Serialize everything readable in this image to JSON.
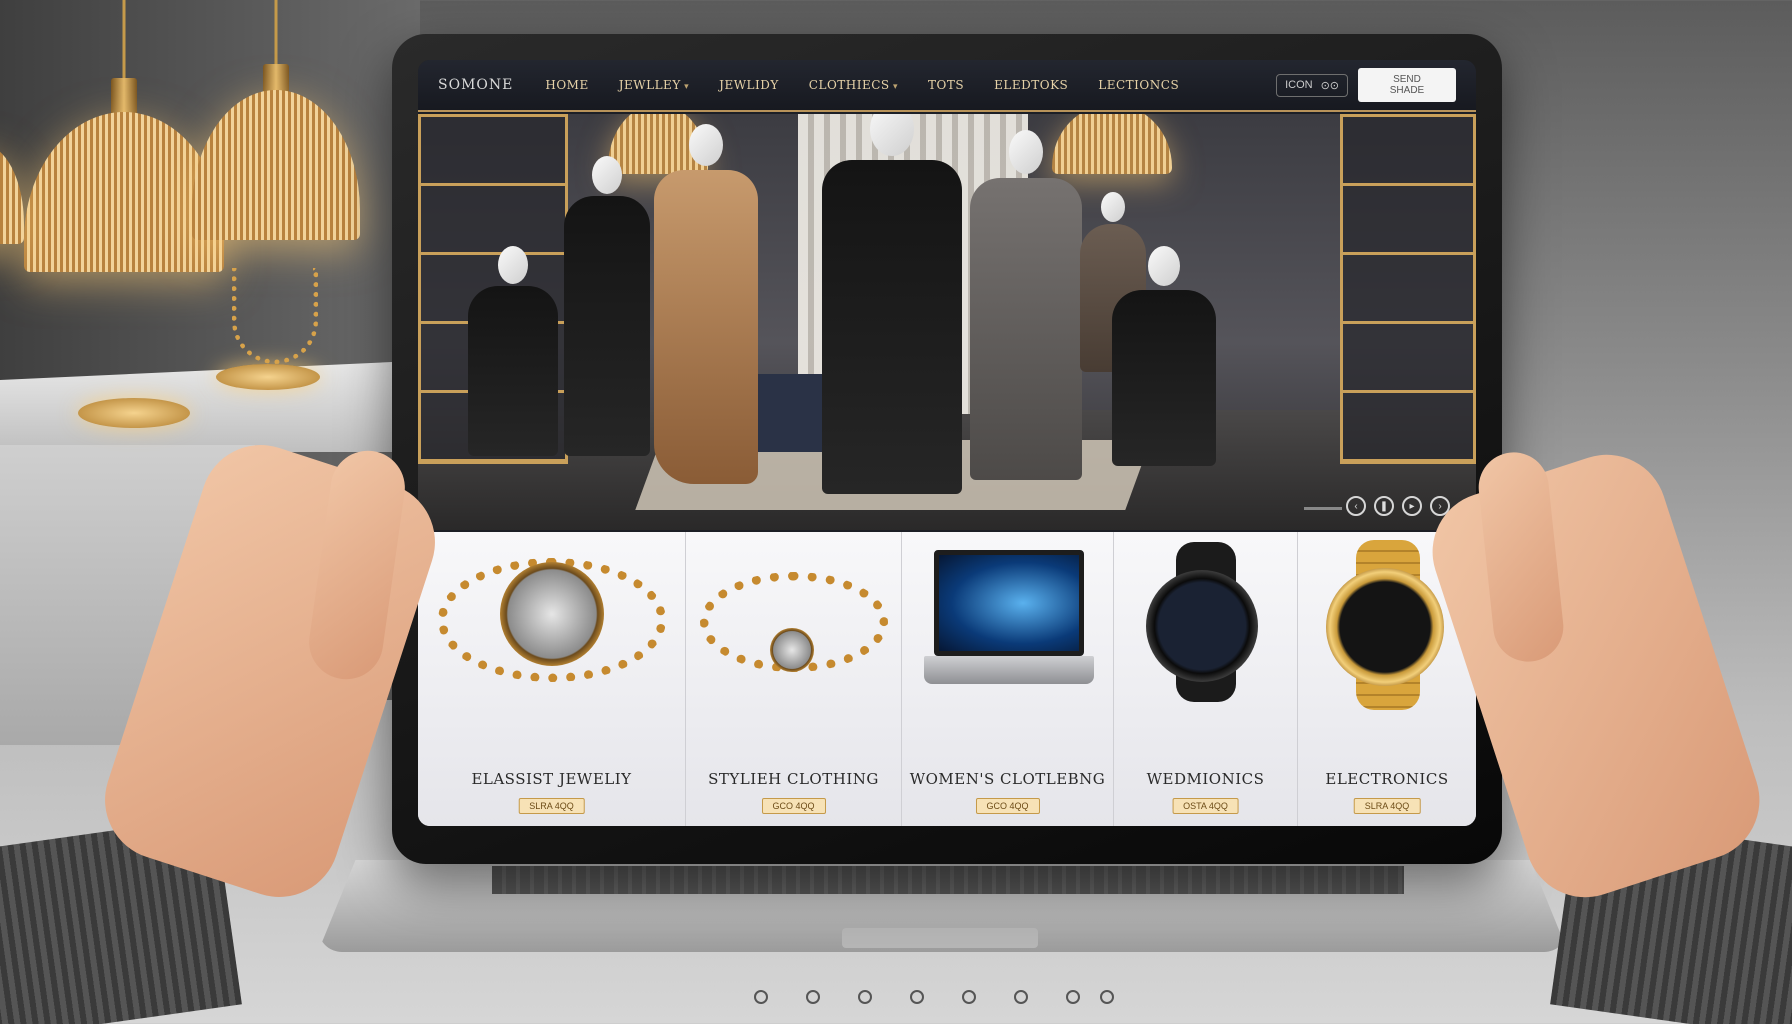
{
  "nav": {
    "brand": "SOMONE",
    "links": [
      "HOME",
      "JEWLLEY",
      "JEWLIDY",
      "CLOTHIECS",
      "TOTS",
      "ELEDTOKS",
      "LECTIONCS"
    ],
    "pill_text": "ICON",
    "search_placeholder": "SEND SHADE"
  },
  "products": [
    {
      "title": "ELASSIST JEWELIY",
      "price": "SLRA 4QQ"
    },
    {
      "title": "STYLIEH CLOTHING",
      "price": "GCO 4QQ"
    },
    {
      "title": "WOMEN'S CLOTLEBNG",
      "price": "GCO 4QQ"
    },
    {
      "title": "WEDMIONICS",
      "price": "OSTA 4QQ"
    },
    {
      "title": "ELECTRONICS",
      "price": "SLRA 4QQ"
    }
  ],
  "icons": {
    "slider_controls": [
      "prev-slide-icon",
      "pause-icon",
      "play-icon",
      "next-slide-icon"
    ]
  },
  "colors": {
    "accent_gold": "#c9a05a",
    "nav_bg": "#1c1f26",
    "card_bg": "#f1f1f4"
  }
}
